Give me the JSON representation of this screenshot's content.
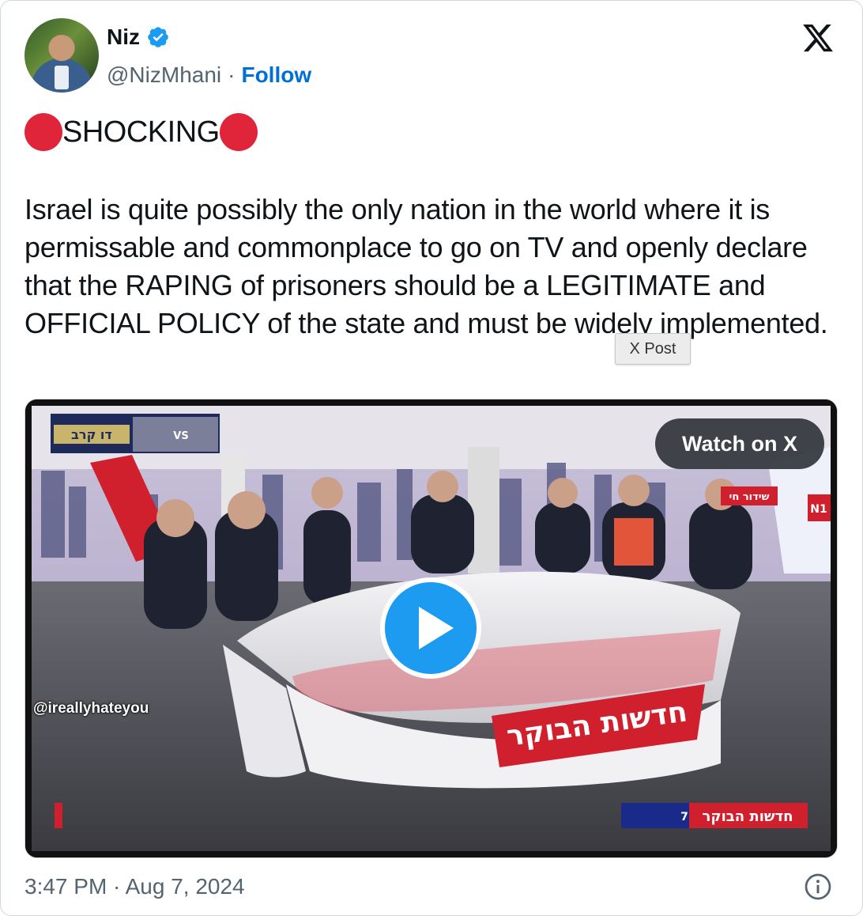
{
  "author": {
    "name": "Niz",
    "handle": "@NizMhani",
    "separator": "·",
    "follow_label": "Follow",
    "avatar_icon": "profile-avatar",
    "verified_icon": "verified-badge-icon"
  },
  "platform_icon": "x-logo-icon",
  "tweet": {
    "headline": "SHOCKING",
    "headline_emoji": "red-circle",
    "body": "Israel is quite possibly the only nation in the world where it is permissable and commonplace to go on TV and openly declare that the RAPING of prisoners should be a LEGITIMATE and OFFICIAL POLICY of the state and must be widely implemented.",
    "tooltip": "X Post"
  },
  "media": {
    "watch_label": "Watch on X",
    "watermark": "@ireallyhateyou",
    "overlay_top_left": "דו קרב",
    "overlay_top_left_vs": "VS",
    "live_badge": "שידור חי",
    "channel_tag": "N1",
    "desk_title": "חדשות הבוקר",
    "lower_third": "חדשות הבוקר",
    "lower_third_number": "7",
    "play_icon": "play-icon"
  },
  "footer": {
    "timestamp": "3:47 PM · Aug 7, 2024",
    "info_icon": "info-icon"
  },
  "colors": {
    "verified_blue": "#1d9bf0",
    "follow_blue": "#006fd6",
    "red_dot": "#e0243a",
    "muted": "#536471",
    "studio_red": "#d0202e"
  }
}
